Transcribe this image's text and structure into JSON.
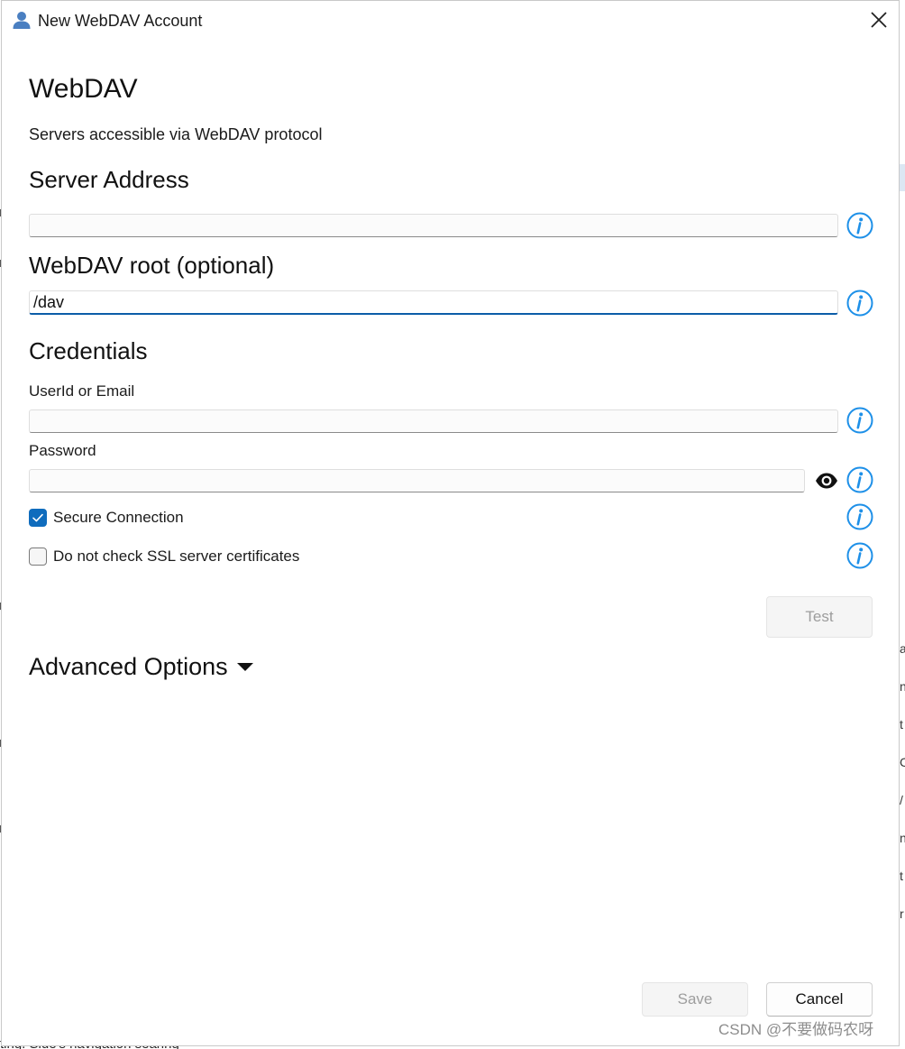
{
  "window": {
    "title": "New WebDAV Account",
    "close_icon": "close-icon",
    "app_icon": "person-icon"
  },
  "header": {
    "title": "WebDAV",
    "subtitle": "Servers accessible via WebDAV protocol"
  },
  "server_address": {
    "heading": "Server Address",
    "value": "",
    "info_icon": "info-icon"
  },
  "webdav_root": {
    "heading": "WebDAV root (optional)",
    "value": "/dav",
    "info_icon": "info-icon"
  },
  "credentials": {
    "heading": "Credentials",
    "userid_label": "UserId or Email",
    "userid_value": "",
    "password_label": "Password",
    "password_value": "",
    "show_password_icon": "eye-icon"
  },
  "options": {
    "secure_connection_label": "Secure Connection",
    "secure_connection_checked": true,
    "no_ssl_check_label": "Do not check SSL server certificates",
    "no_ssl_check_checked": false
  },
  "buttons": {
    "test": "Test",
    "save": "Save",
    "cancel": "Cancel"
  },
  "advanced": {
    "label": "Advanced Options",
    "icon": "caret-down-icon"
  },
  "watermark": "CSDN @不要做码农呀",
  "background": {
    "bottom_text": "ting. Side's navigation searing",
    "right_chars": [
      "a",
      "n",
      "t",
      "C",
      "/",
      "n",
      "t",
      "r"
    ]
  },
  "colors": {
    "accent": "#0f6cbd",
    "info_icon": "#1e90e8",
    "disabled_text": "#9d9d9d"
  }
}
